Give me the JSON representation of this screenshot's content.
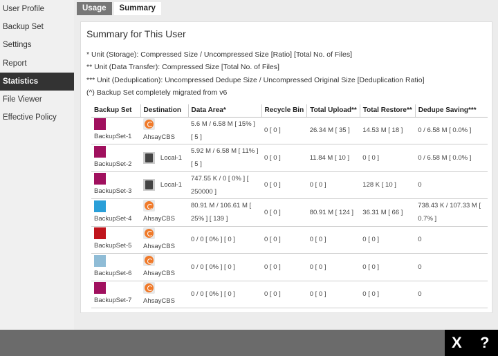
{
  "sidebar": {
    "items": [
      {
        "label": "User Profile"
      },
      {
        "label": "Backup Set"
      },
      {
        "label": "Settings"
      },
      {
        "label": "Report"
      },
      {
        "label": "Statistics",
        "active": true
      },
      {
        "label": "File Viewer"
      },
      {
        "label": "Effective Policy"
      }
    ]
  },
  "tabs": [
    {
      "label": "Usage"
    },
    {
      "label": "Summary",
      "active": true
    }
  ],
  "panel": {
    "title": "Summary for This User",
    "notes": [
      "* Unit (Storage): Compressed Size / Uncompressed Size [Ratio] [Total No. of Files]",
      "** Unit (Data Transfer): Compressed Size [Total No. of Files]",
      "*** Unit (Deduplication): Uncompressed Dedupe Size / Uncompressed Original Size [Deduplication Ratio]",
      "(^) Backup Set completely migrated from v6"
    ]
  },
  "table": {
    "headers": [
      "Backup Set",
      "Destination",
      "Data Area*",
      "Recycle Bin",
      "Total Upload**",
      "Total Restore**",
      "Dedupe Saving***"
    ],
    "rows": [
      {
        "name": "BackupSet-1",
        "icon": "file-icon",
        "color": "#a0105e",
        "dest": "AhsayCBS",
        "dest_icon": "ahsaycbs-icon",
        "data": "5.6 M / 6.58 M [ 15% ] [ 5 ]",
        "recycle": "0 [ 0 ]",
        "upload": "26.34 M [ 35 ]",
        "restore": "14.53 M [ 18 ]",
        "dedupe": "0 / 6.58 M [ 0.0% ]"
      },
      {
        "name": "BackupSet-2",
        "icon": "file-icon",
        "color": "#a0105e",
        "dest": "Local-1",
        "dest_icon": "local-drive-icon",
        "data": "5.92 M / 6.58 M [ 11% ] [ 5 ]",
        "recycle": "0 [ 0 ]",
        "upload": "11.84 M [ 10 ]",
        "restore": "0 [ 0 ]",
        "dedupe": "0 / 6.58 M [ 0.0% ]"
      },
      {
        "name": "BackupSet-3",
        "icon": "file-icon",
        "color": "#a0105e",
        "dest": "Local-1",
        "dest_icon": "local-drive-icon",
        "data": "747.55 K / 0 [ 0% ] [ 250000 ]",
        "recycle": "0 [ 0 ]",
        "upload": "0 [ 0 ]",
        "restore": "128 K [ 10 ]",
        "dedupe": "0"
      },
      {
        "name": "BackupSet-4",
        "icon": "cloud-file-icon",
        "color": "#2a9fd8",
        "dest": "AhsayCBS",
        "dest_icon": "ahsaycbs-icon",
        "data": "80.91 M / 106.61 M [ 25% ] [ 139 ]",
        "recycle": "0 [ 0 ]",
        "upload": "80.91 M [ 124 ]",
        "restore": "36.31 M [ 66 ]",
        "dedupe": "738.43 K / 107.33 M [ 0.7% ]"
      },
      {
        "name": "BackupSet-5",
        "icon": "database-icon",
        "color": "#c0141c",
        "dest": "AhsayCBS",
        "dest_icon": "ahsaycbs-icon",
        "data": "0 / 0 [ 0% ] [ 0 ]",
        "recycle": "0 [ 0 ]",
        "upload": "0 [ 0 ]",
        "restore": "0 [ 0 ]",
        "dedupe": "0"
      },
      {
        "name": "BackupSet-6",
        "icon": "vm-icon",
        "color": "#8fbcd6",
        "dest": "AhsayCBS",
        "dest_icon": "ahsaycbs-icon",
        "data": "0 / 0 [ 0% ] [ 0 ]",
        "recycle": "0 [ 0 ]",
        "upload": "0 [ 0 ]",
        "restore": "0 [ 0 ]",
        "dedupe": "0"
      },
      {
        "name": "BackupSet-7",
        "icon": "file-icon",
        "color": "#a0105e",
        "dest": "AhsayCBS",
        "dest_icon": "ahsaycbs-icon",
        "data": "0 / 0 [ 0% ] [ 0 ]",
        "recycle": "0 [ 0 ]",
        "upload": "0 [ 0 ]",
        "restore": "0 [ 0 ]",
        "dedupe": "0"
      }
    ]
  },
  "footer": {
    "close": "X",
    "help": "?"
  }
}
